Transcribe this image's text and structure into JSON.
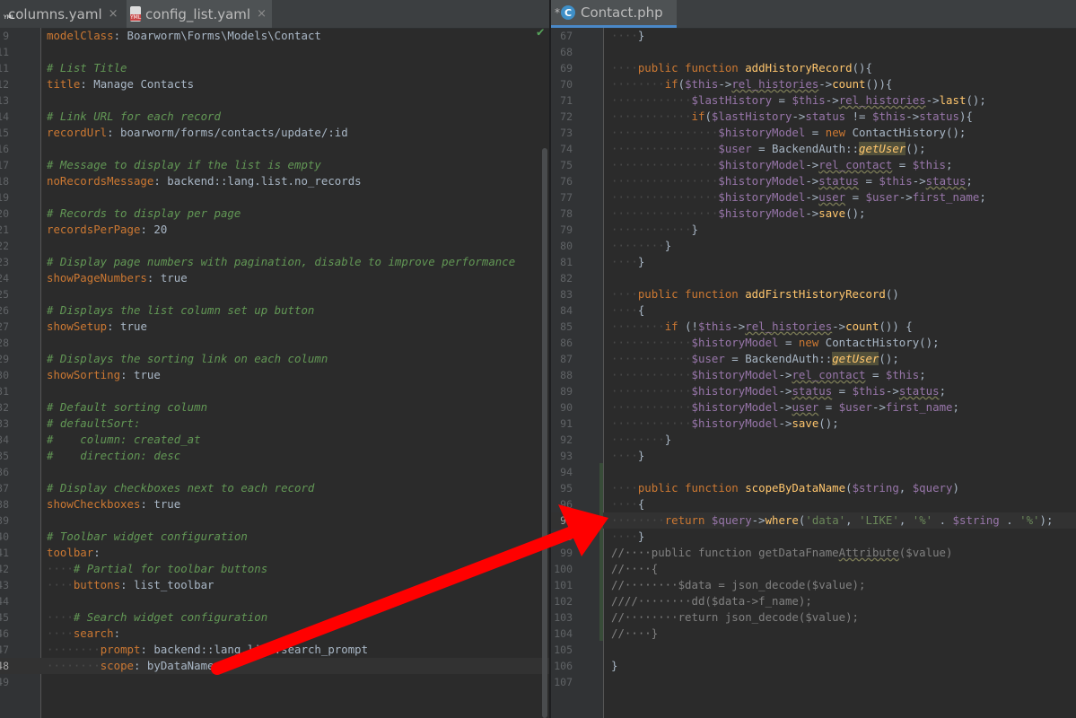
{
  "left_tabs": [
    {
      "label": "columns.yaml",
      "close": "×"
    },
    {
      "label": "config_list.yaml",
      "close": "×"
    }
  ],
  "right_tab": {
    "label": "Contact.php",
    "modified_marker": "*"
  },
  "yaml_icon_text": "YML",
  "php_icon_text": "C",
  "left_lines": [
    {
      "n": "9",
      "html": "<span class=\"y\">modelClass</span>: Boarworm\\Forms\\Models\\Contact"
    },
    {
      "n": "11",
      "html": ""
    },
    {
      "n": "11",
      "html": "<span class=\"cm\"># List Title</span>"
    },
    {
      "n": "12",
      "html": "<span class=\"y\">title</span>: Manage Contacts"
    },
    {
      "n": "13",
      "html": ""
    },
    {
      "n": "14",
      "html": "<span class=\"cm\"># Link URL for each record</span>"
    },
    {
      "n": "15",
      "html": "<span class=\"y\">recordUrl</span>: boarworm/forms/contacts/update/:id"
    },
    {
      "n": "16",
      "html": ""
    },
    {
      "n": "17",
      "html": "<span class=\"cm\"># Message to display if the list is empty</span>"
    },
    {
      "n": "18",
      "html": "<span class=\"y\">noRecordsMessage</span>: backend::lang.list.no_records"
    },
    {
      "n": "19",
      "html": ""
    },
    {
      "n": "20",
      "html": "<span class=\"cm\"># Records to display per page</span>"
    },
    {
      "n": "21",
      "html": "<span class=\"y\">recordsPerPage</span>: 20"
    },
    {
      "n": "22",
      "html": ""
    },
    {
      "n": "23",
      "html": "<span class=\"cm\"># Display page numbers with pagination, disable to improve performance</span>"
    },
    {
      "n": "24",
      "html": "<span class=\"y\">showPageNumbers</span>: true"
    },
    {
      "n": "25",
      "html": ""
    },
    {
      "n": "26",
      "html": "<span class=\"cm\"># Displays the list column set up button</span>"
    },
    {
      "n": "27",
      "html": "<span class=\"y\">showSetup</span>: true"
    },
    {
      "n": "28",
      "html": ""
    },
    {
      "n": "29",
      "html": "<span class=\"cm\"># Displays the sorting link on each column</span>"
    },
    {
      "n": "30",
      "html": "<span class=\"y\">showSorting</span>: true"
    },
    {
      "n": "31",
      "html": ""
    },
    {
      "n": "32",
      "html": "<span class=\"cm\"># Default sorting column</span>"
    },
    {
      "n": "33",
      "html": "<span class=\"cm\"># defaultSort:</span>"
    },
    {
      "n": "34",
      "html": "<span class=\"cm\">#    column: created_at</span>"
    },
    {
      "n": "35",
      "html": "<span class=\"cm\">#    direction: desc</span>"
    },
    {
      "n": "36",
      "html": ""
    },
    {
      "n": "37",
      "html": "<span class=\"cm\"># Display checkboxes next to each record</span>"
    },
    {
      "n": "38",
      "html": "<span class=\"y\">showCheckboxes</span>: true"
    },
    {
      "n": "39",
      "html": ""
    },
    {
      "n": "40",
      "html": "<span class=\"cm\"># Toolbar widget configuration</span>"
    },
    {
      "n": "41",
      "html": "<span class=\"y\">toolbar</span>:"
    },
    {
      "n": "42",
      "html": "<span class=\"dot\">····</span><span class=\"cm\"># Partial for toolbar buttons</span>"
    },
    {
      "n": "43",
      "html": "<span class=\"dot\">····</span><span class=\"y\">buttons</span>: list_toolbar"
    },
    {
      "n": "44",
      "html": ""
    },
    {
      "n": "45",
      "html": "<span class=\"dot\">····</span><span class=\"cm\"># Search widget configuration</span>"
    },
    {
      "n": "46",
      "html": "<span class=\"dot\">····</span><span class=\"y\">search</span>:"
    },
    {
      "n": "47",
      "html": "<span class=\"dot\">········</span><span class=\"y\">prompt</span>: backend::lang.list.search_prompt"
    },
    {
      "n": "48",
      "html": "<span class=\"dot\">········</span><span class=\"y\">scope</span>: byDataName",
      "current": true
    },
    {
      "n": "49",
      "html": ""
    }
  ],
  "right_lines": [
    {
      "n": "67",
      "html": "<span class=\"dot\">····</span>}"
    },
    {
      "n": "68",
      "html": ""
    },
    {
      "n": "69",
      "html": "<span class=\"dot\">····</span><span class=\"k\">public function </span><span class=\"f\">addHistoryRecord</span>(){"
    },
    {
      "n": "70",
      "html": "<span class=\"dot\">········</span><span class=\"k\">if</span>(<span class=\"v\">$this</span>-><span class=\"v und\">rel_histories</span>-><span class=\"f\">count</span>()){"
    },
    {
      "n": "71",
      "html": "<span class=\"dot\">············</span><span class=\"v\">$lastHistory</span> = <span class=\"v\">$this</span>-><span class=\"v und\">rel_histories</span>-><span class=\"f\">last</span>();"
    },
    {
      "n": "72",
      "html": "<span class=\"dot\">············</span><span class=\"k\">if</span>(<span class=\"v\">$lastHistory</span>-><span class=\"v\">status</span> != <span class=\"v\">$this</span>-><span class=\"v\">status</span>){"
    },
    {
      "n": "73",
      "html": "<span class=\"dot\">················</span><span class=\"v\">$historyModel</span> = <span class=\"k\">new </span>ContactHistory();"
    },
    {
      "n": "74",
      "html": "<span class=\"dot\">················</span><span class=\"v\">$user</span> = BackendAuth::<span class=\"hl\">getUser</span>();"
    },
    {
      "n": "75",
      "html": "<span class=\"dot\">················</span><span class=\"v\">$historyModel</span>-><span class=\"v und\">rel_contact</span> = <span class=\"v\">$this</span>;"
    },
    {
      "n": "76",
      "html": "<span class=\"dot\">················</span><span class=\"v\">$historyModel</span>-><span class=\"v und\">status</span> = <span class=\"v\">$this</span>-><span class=\"v und\">status</span>;"
    },
    {
      "n": "77",
      "html": "<span class=\"dot\">················</span><span class=\"v\">$historyModel</span>-><span class=\"v und\">user</span> = <span class=\"v\">$user</span>-><span class=\"v\">first_name</span>;"
    },
    {
      "n": "78",
      "html": "<span class=\"dot\">················</span><span class=\"v\">$historyModel</span>-><span class=\"f\">save</span>();"
    },
    {
      "n": "79",
      "html": "<span class=\"dot\">············</span>}"
    },
    {
      "n": "80",
      "html": "<span class=\"dot\">········</span>}"
    },
    {
      "n": "81",
      "html": "<span class=\"dot\">····</span>}"
    },
    {
      "n": "82",
      "html": ""
    },
    {
      "n": "83",
      "html": "<span class=\"dot\">····</span><span class=\"k\">public function </span><span class=\"f\">addFirstHistoryRecord</span>()"
    },
    {
      "n": "84",
      "html": "<span class=\"dot\">····</span>{"
    },
    {
      "n": "85",
      "html": "<span class=\"dot\">········</span><span class=\"k\">if </span>(!<span class=\"v\">$this</span>-><span class=\"v und\">rel_histories</span>-><span class=\"f\">count</span>()) {"
    },
    {
      "n": "86",
      "html": "<span class=\"dot\">············</span><span class=\"v\">$historyModel</span> = <span class=\"k\">new </span>ContactHistory();"
    },
    {
      "n": "87",
      "html": "<span class=\"dot\">············</span><span class=\"v\">$user</span> = BackendAuth::<span class=\"hl\">getUser</span>();"
    },
    {
      "n": "88",
      "html": "<span class=\"dot\">············</span><span class=\"v\">$historyModel</span>-><span class=\"v und\">rel_contact</span> = <span class=\"v\">$this</span>;"
    },
    {
      "n": "89",
      "html": "<span class=\"dot\">············</span><span class=\"v\">$historyModel</span>-><span class=\"v und\">status</span> = <span class=\"v\">$this</span>-><span class=\"v und\">status</span>;"
    },
    {
      "n": "90",
      "html": "<span class=\"dot\">············</span><span class=\"v\">$historyModel</span>-><span class=\"v und\">user</span> = <span class=\"v\">$user</span>-><span class=\"v\">first_name</span>;"
    },
    {
      "n": "91",
      "html": "<span class=\"dot\">············</span><span class=\"v\">$historyModel</span>-><span class=\"f\">save</span>();"
    },
    {
      "n": "92",
      "html": "<span class=\"dot\">········</span>}"
    },
    {
      "n": "93",
      "html": "<span class=\"dot\">····</span>}"
    },
    {
      "n": "94",
      "html": ""
    },
    {
      "n": "95",
      "html": "<span class=\"dot\">····</span><span class=\"k\">public function </span><span class=\"f\">scopeByDataName</span>(<span class=\"v\">$string</span>, <span class=\"v\">$query</span>)"
    },
    {
      "n": "96",
      "html": "<span class=\"dot\">····</span>{"
    },
    {
      "n": "97",
      "html": "<span class=\"dot\">········</span><span class=\"k\">return </span><span class=\"v\">$query</span>-><span class=\"f\">where</span>(<span class=\"s\">'data'</span>, <span class=\"s\">'LIKE'</span>, <span class=\"s\">'%'</span> . <span class=\"v\">$string</span> . <span class=\"s\">'%'</span>);",
      "current": true
    },
    {
      "n": "98",
      "html": "<span class=\"dot\">····</span>}"
    },
    {
      "n": "99",
      "html": "<span class=\"lc\">//····public function getDataFname</span><span class=\"lc und\">Attribute</span><span class=\"lc\">($value)</span>"
    },
    {
      "n": "100",
      "html": "<span class=\"lc\">//····{</span>"
    },
    {
      "n": "101",
      "html": "<span class=\"lc\">//········$data = json_decode($value);</span>"
    },
    {
      "n": "102",
      "html": "<span class=\"lc\">////········dd($data->f_name);</span>"
    },
    {
      "n": "103",
      "html": "<span class=\"lc\">//········return json_decode($value);</span>"
    },
    {
      "n": "104",
      "html": "<span class=\"lc\">//····}</span>"
    },
    {
      "n": "105",
      "html": ""
    },
    {
      "n": "106",
      "html": "}"
    },
    {
      "n": "107",
      "html": ""
    }
  ]
}
